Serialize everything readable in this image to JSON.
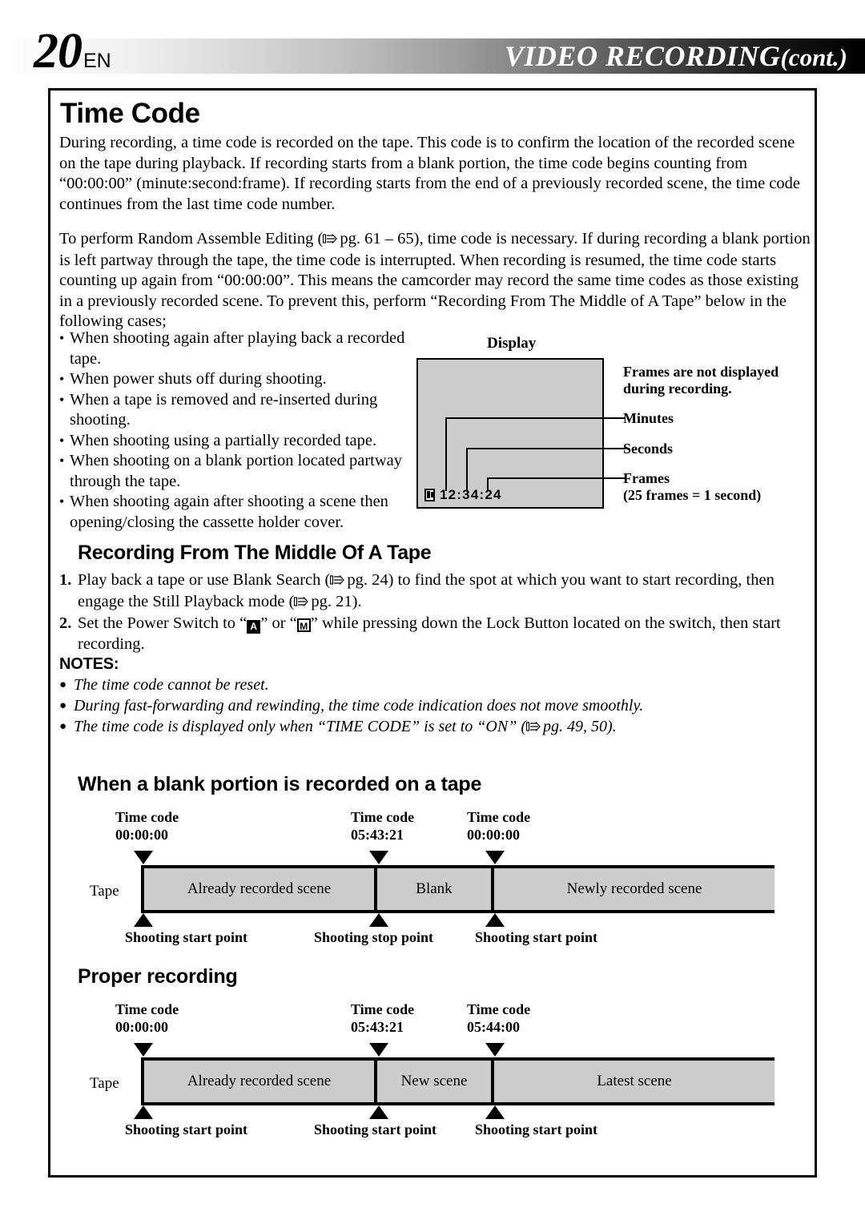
{
  "header": {
    "page_number": "20",
    "language": "EN",
    "title": "VIDEO  RECORDING",
    "title_cont": "(cont.)"
  },
  "sections": {
    "time_code_title": "Time Code",
    "recording_middle_title": "Recording From The Middle Of A Tape",
    "blank_portion_title": "When a blank portion is recorded on a tape",
    "proper_recording_title": "Proper recording",
    "notes_title": "NOTES:"
  },
  "paragraphs": {
    "p1": "During recording, a time code is recorded on the tape. This code is to confirm the location of the recorded scene on the tape during playback. If recording starts from a blank portion, the time code begins counting from “00:00:00” (minute:second:frame). If recording starts from the end of a previously recorded scene, the time code continues from the last time code number.",
    "p2_a": "To perform Random Assemble Editing (",
    "p2_ref": "pg. 61 – 65",
    "p2_b": "), time code is necessary. If during recording a blank portion is left partway through the tape, the time code is interrupted. When recording is resumed, the time code starts counting up again from “00:00:00”. This means the camcorder may record the same time codes as those existing in a previously recorded scene. To prevent this, perform “Recording From The Middle of A Tape” below in the following cases;"
  },
  "bullets": [
    "When shooting again after playing back a recorded tape.",
    "When power shuts off during shooting.",
    "When a tape is removed and re-inserted during shooting.",
    "When shooting using a partially recorded tape.",
    "When shooting on a blank portion located partway through the tape.",
    "When shooting again after shooting a scene then opening/closing the cassette holder cover."
  ],
  "display_figure": {
    "caption": "Display",
    "timecode": "12:34:24",
    "icon": "cassette-tape-icon",
    "labels": {
      "frames_note": "Frames are not displayed during recording.",
      "minutes": "Minutes",
      "seconds": "Seconds",
      "frames": "Frames",
      "frames_sub": "(25 frames = 1 second)"
    }
  },
  "steps": [
    {
      "num": "1.",
      "text_a": "Play back a tape or use Blank Search (",
      "ref_a": "pg. 24",
      "text_b": ") to find the spot at which you want to start recording, then engage the Still Playback mode (",
      "ref_b": "pg. 21",
      "text_c": ")."
    },
    {
      "num": "2.",
      "text_a": "Set the Power Switch to “",
      "key_a": "A",
      "text_b": "” or “",
      "key_b": "M",
      "text_c": "” while pressing down the Lock Button located on the switch, then start recording."
    }
  ],
  "notes": [
    {
      "text": "The time code cannot be reset."
    },
    {
      "text": "During fast-forwarding and rewinding, the time code indication does not move smoothly."
    },
    {
      "text_a": "The time code is displayed only when “TIME CODE” is set to “ON” (",
      "ref": "pg. 49, 50",
      "text_b": ")."
    }
  ],
  "chart_data": [
    {
      "type": "table",
      "title": "When a blank portion is recorded on a tape",
      "row_label": "Tape",
      "timecode_heading": "Time code",
      "markers": [
        {
          "timecode": "00:00:00",
          "point_label": "Shooting start point"
        },
        {
          "timecode": "05:43:21",
          "point_label": "Shooting stop point"
        },
        {
          "timecode": "00:00:00",
          "point_label": "Shooting start point"
        }
      ],
      "segments": [
        {
          "label": "Already recorded scene"
        },
        {
          "label": "Blank"
        },
        {
          "label": "Newly recorded scene"
        }
      ]
    },
    {
      "type": "table",
      "title": "Proper recording",
      "row_label": "Tape",
      "timecode_heading": "Time code",
      "markers": [
        {
          "timecode": "00:00:00",
          "point_label": "Shooting start point"
        },
        {
          "timecode": "05:43:21",
          "point_label": "Shooting start point"
        },
        {
          "timecode": "05:44:00",
          "point_label": "Shooting start point"
        }
      ],
      "segments": [
        {
          "label": "Already recorded scene"
        },
        {
          "label": "New scene"
        },
        {
          "label": "Latest scene"
        }
      ]
    }
  ]
}
